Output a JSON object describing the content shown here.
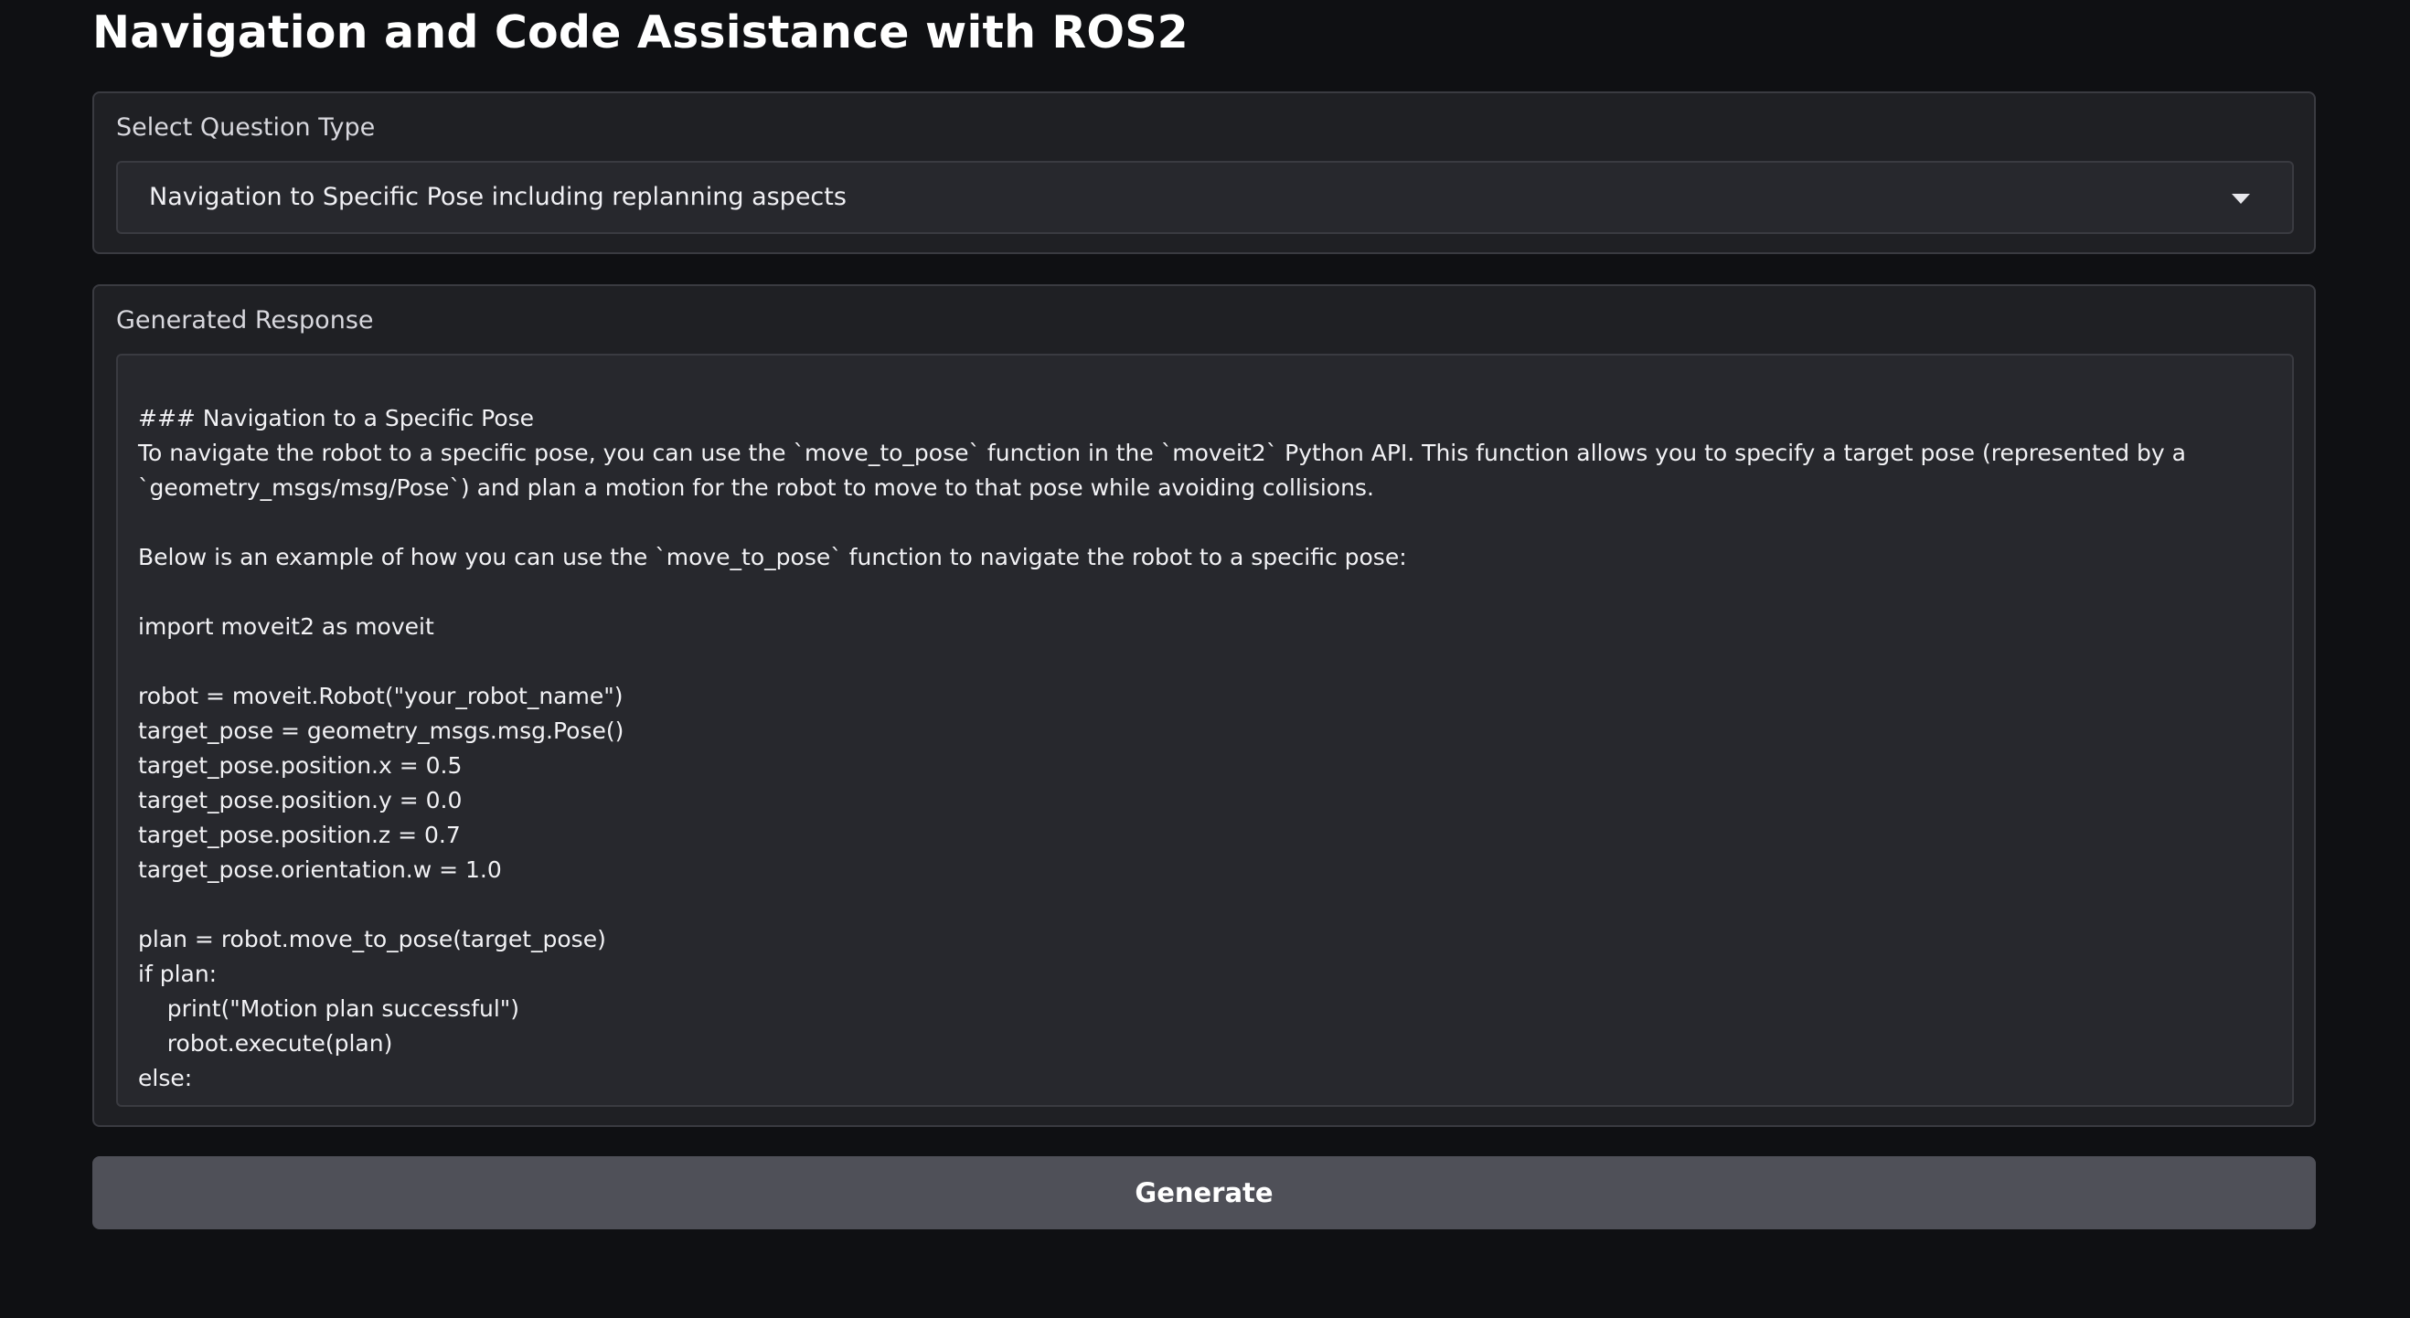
{
  "page": {
    "title": "Navigation and Code Assistance with ROS2"
  },
  "question_type": {
    "label": "Select Question Type",
    "selected": "Navigation to Specific Pose including replanning aspects",
    "icon": "chevron-down-icon"
  },
  "response": {
    "label": "Generated Response",
    "text": "### Navigation to a Specific Pose\nTo navigate the robot to a specific pose, you can use the `move_to_pose` function in the `moveit2` Python API. This function allows you to specify a target pose (represented by a `geometry_msgs/msg/Pose`) and plan a motion for the robot to move to that pose while avoiding collisions.\n\nBelow is an example of how you can use the `move_to_pose` function to navigate the robot to a specific pose:\n\nimport moveit2 as moveit\n\nrobot = moveit.Robot(\"your_robot_name\")\ntarget_pose = geometry_msgs.msg.Pose()\ntarget_pose.position.x = 0.5\ntarget_pose.position.y = 0.0\ntarget_pose.position.z = 0.7\ntarget_pose.orientation.w = 1.0\n\nplan = robot.move_to_pose(target_pose)\nif plan:\n    print(\"Motion plan successful\")\n    robot.execute(plan)\nelse:"
  },
  "actions": {
    "generate_label": "Generate"
  },
  "colors": {
    "background": "#0f1013",
    "panel": "#1f2024",
    "field": "#27282d",
    "border": "#3a3b41",
    "button": "#4f5058"
  }
}
